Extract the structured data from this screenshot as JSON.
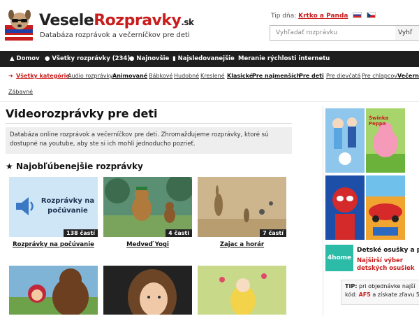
{
  "header": {
    "logo_part1": "Vesele",
    "logo_part2": "Rozpravky",
    "logo_tld": ".sk",
    "tagline": "Databáza rozprávok a večerníčkov pre deti",
    "tip_label": "Tip dňa:",
    "tip_link": "Krtko a Panda",
    "search_placeholder": "Vyhľadať rozprávku",
    "search_button": "Vyhľ"
  },
  "nav": {
    "items": [
      {
        "icon": "▲",
        "label": "Domov"
      },
      {
        "icon": "●",
        "label": "Všetky rozprávky (234)"
      },
      {
        "icon": "●",
        "label": "Najnovšie"
      },
      {
        "icon": "▮",
        "label": "Najsledovanejšie"
      },
      {
        "icon": "",
        "label": "Meranie rýchlosti internetu"
      }
    ]
  },
  "categories": [
    {
      "label": "Všetky kategórie",
      "style": "first"
    },
    {
      "label": "Audio rozprávky",
      "style": "normal"
    },
    {
      "label": "Animované",
      "style": "bold"
    },
    {
      "label": "Bábkové",
      "style": "normal"
    },
    {
      "label": "Hudobné",
      "style": "normal"
    },
    {
      "label": "Kreslené",
      "style": "normal"
    },
    {
      "label": "Klasické",
      "style": "bold"
    },
    {
      "label": "Pre najmenších",
      "style": "bold"
    },
    {
      "label": "Pre deti",
      "style": "bold"
    },
    {
      "label": "Pre dievčatá",
      "style": "normal"
    },
    {
      "label": "Pre chlapcov",
      "style": "normal"
    },
    {
      "label": "Večern",
      "style": "bold"
    },
    {
      "label": "Zábavné",
      "style": "normal"
    }
  ],
  "main": {
    "title": "Videorozprávky pre deti",
    "intro": "Databáza online rozprávok a večerníčkov pre deti. Zhromažďujeme rozprávky, ktoré sú dostupné na youtube, aby ste si ich mohli jednoducho pozrieť.",
    "section_title": "Najobľúbenejšie rozprávky",
    "audio_tile_text": "Rozprávky na počúvanie",
    "cards": [
      {
        "title": "Rozprávky na počúvanie",
        "badge": "138 častí"
      },
      {
        "title": "Medveď Yogi",
        "badge": "4 časti"
      },
      {
        "title": "Zajac a horár",
        "badge": "7 častí"
      },
      {
        "title": "",
        "badge": ""
      },
      {
        "title": "",
        "badge": ""
      },
      {
        "title": "",
        "badge": ""
      }
    ]
  },
  "sidebar": {
    "ad_tile_text": "Świnka Peppa",
    "ad_brand": "4home",
    "ad_headline": "Detské osušky a po",
    "ad_offer": "Najširší výber detských osušiek",
    "tip_label": "TIP:",
    "tip_text_1": "pri objednávke najší",
    "tip_text_2": "kód:",
    "tip_code": "AF5",
    "tip_text_3": "a získate zľavu 5"
  },
  "colors": {
    "accent": "#c91c1c",
    "nav_bg": "#1f1f1f"
  }
}
